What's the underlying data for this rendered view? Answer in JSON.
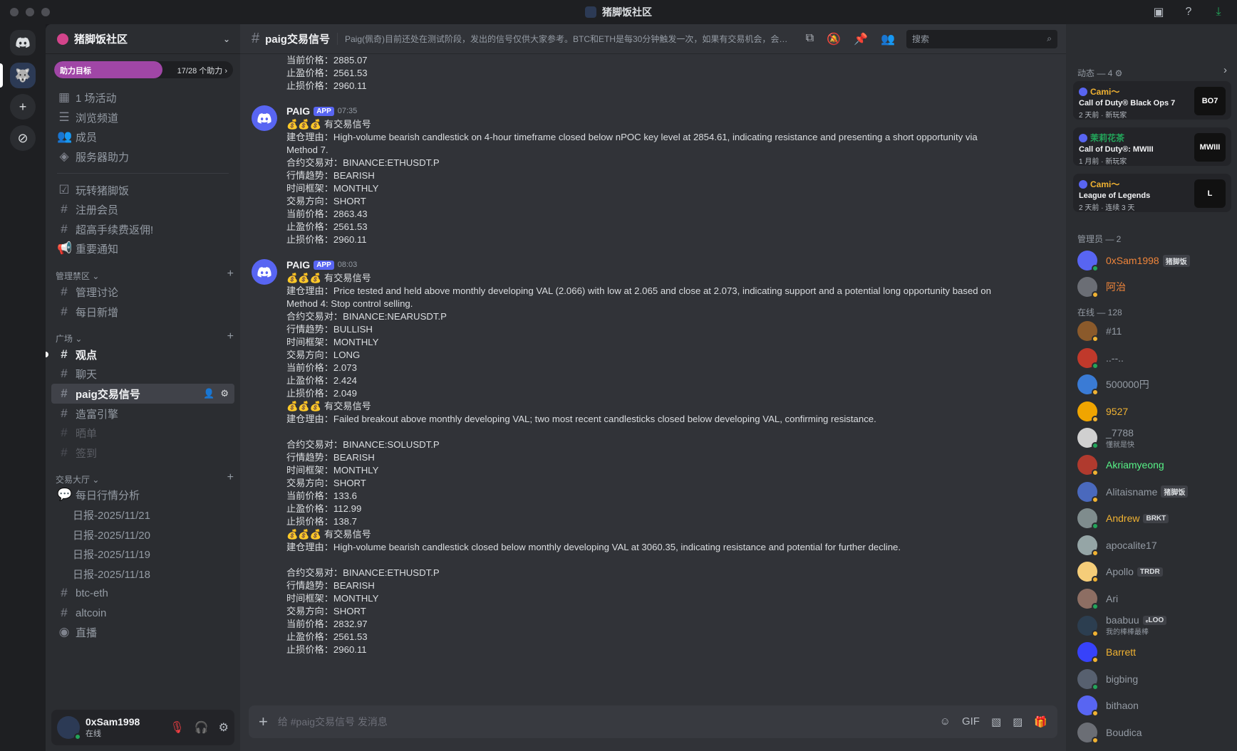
{
  "window": {
    "title": "猪脚饭社区"
  },
  "sidebar": {
    "server_name": "猪脚饭社区",
    "boost_label": "助力目标",
    "boost_count": "17/28 个助力",
    "boost_progress": 0.607,
    "top_items": [
      "1 场活动",
      "浏览频道",
      "成员",
      "服务器助力"
    ],
    "general": [
      "玩转猪脚饭",
      "注册会员",
      "超高手续费返佣!",
      "重要通知"
    ],
    "cat_admin": "管理禁区",
    "admin_channels": [
      "管理讨论",
      "每日新增"
    ],
    "cat_square": "广场",
    "square_channels": [
      "观点",
      "聊天",
      "paig交易信号",
      "造富引擎",
      "晒单",
      "签到"
    ],
    "cat_hall": "交易大厅",
    "hall_forum": "每日行情分析",
    "threads": [
      "日报-2025/11/21",
      "日报-2025/11/20",
      "日报-2025/11/19",
      "日报-2025/11/18"
    ],
    "hall_channels": [
      "btc-eth",
      "altcoin",
      "直播"
    ]
  },
  "user": {
    "name": "0xSam1998",
    "status": "在线"
  },
  "header": {
    "channel": "paig交易信号",
    "topic": "Paig(佩奇)目前还处在测试阶段，发出的信号仅供大家参考。BTC和ETH是每30分钟触发一次，如果有交易机会，会有新的消息。山寨币监控了市值前30的...",
    "search_placeholder": "搜索"
  },
  "messages": {
    "top": [
      "当前价格：2885.07",
      "止盈价格：2561.53",
      "止损价格：2960.11"
    ],
    "m1": {
      "author": "PAIG",
      "badge": "APP",
      "time": "07:35",
      "lines": [
        "💰💰💰 有交易信号",
        "建仓理由：High-volume bearish candlestick on 4-hour timeframe closed below nPOC key level at 2854.61, indicating resistance and presenting a short opportunity via Method 7.",
        "合约交易对：BINANCE:ETHUSDT.P",
        "行情趋势：BEARISH",
        "时间框架：MONTHLY",
        "交易方向：SHORT",
        "当前价格：2863.43",
        "止盈价格：2561.53",
        "止损价格：2960.11"
      ]
    },
    "m2": {
      "author": "PAIG",
      "badge": "APP",
      "time": "08:03",
      "lines": [
        "💰💰💰 有交易信号",
        "建仓理由：Price tested and held above monthly developing VAL (2.066) with low at 2.065 and close at 2.073, indicating support and a potential long opportunity based on Method 4: Stop control selling.",
        "合约交易对：BINANCE:NEARUSDT.P",
        "行情趋势：BULLISH",
        "时间框架：MONTHLY",
        "交易方向：LONG",
        "当前价格：2.073",
        "止盈价格：2.424",
        "止损价格：2.049",
        "💰💰💰 有交易信号",
        "建仓理由：Failed breakout above monthly developing VAL; two most recent candlesticks closed below developing VAL, confirming resistance.",
        "合约交易对：BINANCE:SOLUSDT.P",
        "行情趋势：BEARISH",
        "时间框架：MONTHLY",
        "交易方向：SHORT",
        "当前价格：133.6",
        "止盈价格：112.99",
        "止损价格：138.7",
        "💰💰💰 有交易信号",
        "建仓理由：High-volume bearish candlestick closed below monthly developing VAL at 3060.35, indicating resistance and potential for further decline.",
        "合约交易对：BINANCE:ETHUSDT.P",
        "行情趋势：BEARISH",
        "时间框架：MONTHLY",
        "交易方向：SHORT",
        "当前价格：2832.97",
        "止盈价格：2561.53",
        "止损价格：2960.11"
      ]
    },
    "composer_placeholder": "给 #paig交易信号 发消息"
  },
  "right": {
    "activity_title": "动态 — 4",
    "activities": [
      {
        "who": "Cami～",
        "game": "Call of Duty® Black Ops 7",
        "meta": "2 天前 · 新玩家",
        "thumb": "BO7",
        "color": "#f0b232"
      },
      {
        "who": "茉莉花茶",
        "game": "Call of Duty®: MWIII",
        "meta": "1 月前 · 新玩家",
        "thumb": "MWIII",
        "color": "#23a55a"
      },
      {
        "who": "Cami～",
        "game": "League of Legends",
        "meta": "2 天前 · 连续 3 天",
        "thumb": "L",
        "color": "#f0b232"
      }
    ],
    "admin_title": "管理员 — 2",
    "admins": [
      {
        "name": "0xSam1998",
        "tag": "猪脚饭",
        "color": "#f0853a"
      },
      {
        "name": "阿治",
        "tag": "",
        "color": "#f0853a"
      }
    ],
    "online_title": "在线 — 128",
    "members": [
      {
        "name": "#11",
        "sub": "",
        "tag": "",
        "color": "#949ba4"
      },
      {
        "name": "..--..",
        "sub": "",
        "tag": "",
        "color": "#949ba4"
      },
      {
        "name": "500000円",
        "sub": "",
        "tag": "",
        "color": "#949ba4"
      },
      {
        "name": "9527",
        "sub": "",
        "tag": "",
        "color": "#f0b232"
      },
      {
        "name": "_7788",
        "sub": "懂就是快",
        "tag": "",
        "color": "#949ba4"
      },
      {
        "name": "Akriamyeong",
        "sub": "",
        "tag": "",
        "color": "#57f287"
      },
      {
        "name": "Alitaisname",
        "sub": "",
        "tag": "猪脚饭",
        "color": "#949ba4"
      },
      {
        "name": "Andrew",
        "sub": "",
        "tag": "BRKT",
        "color": "#f0b232"
      },
      {
        "name": "apocalite17",
        "sub": "",
        "tag": "",
        "color": "#949ba4"
      },
      {
        "name": "Apollo",
        "sub": "",
        "tag": "TRDR",
        "color": "#949ba4"
      },
      {
        "name": "Ari",
        "sub": "",
        "tag": "",
        "color": "#949ba4"
      },
      {
        "name": "baabuu",
        "sub": "我的棒棒最棒",
        "tag": "ₑLOO",
        "color": "#949ba4"
      },
      {
        "name": "Barrett",
        "sub": "",
        "tag": "",
        "color": "#f0b232"
      },
      {
        "name": "bigbing",
        "sub": "",
        "tag": "",
        "color": "#949ba4"
      },
      {
        "name": "bithaon",
        "sub": "",
        "tag": "",
        "color": "#949ba4"
      },
      {
        "name": "Boudica",
        "sub": "",
        "tag": "",
        "color": "#949ba4"
      }
    ]
  }
}
